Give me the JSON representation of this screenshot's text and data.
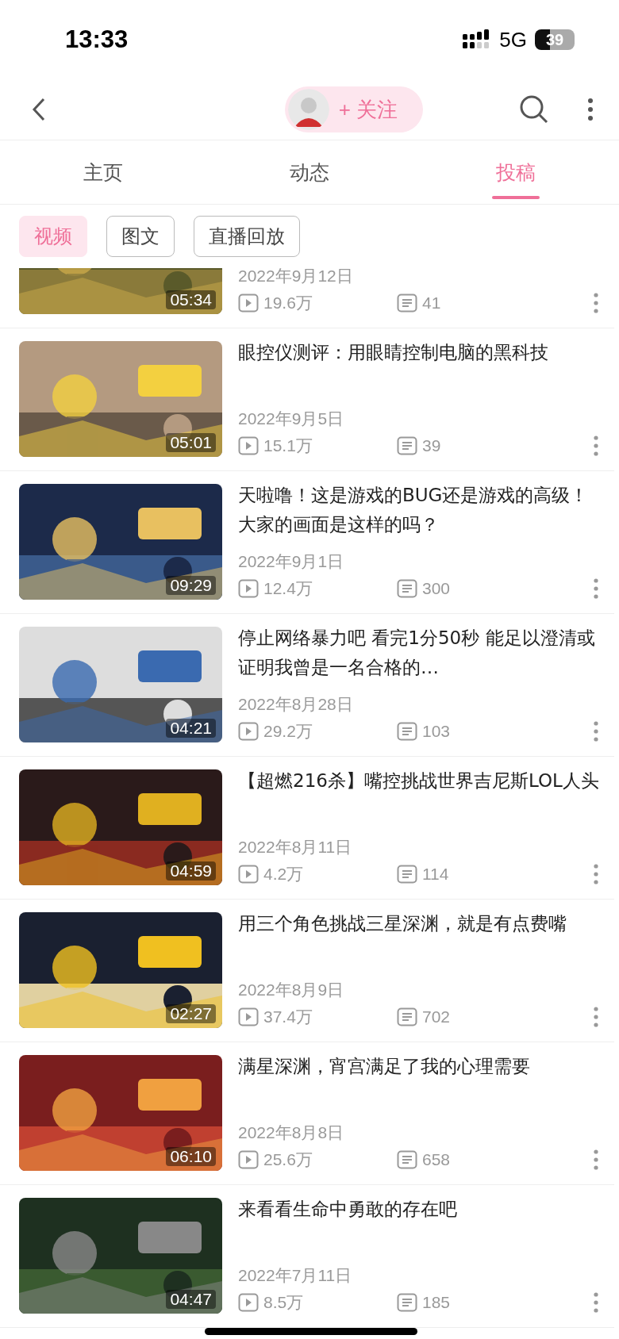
{
  "status_bar": {
    "time": "13:33",
    "network": "5G",
    "battery": "39"
  },
  "nav": {
    "follow_label": "+ 关注"
  },
  "tabs": [
    {
      "label": "主页",
      "selected": false
    },
    {
      "label": "动态",
      "selected": false
    },
    {
      "label": "投稿",
      "selected": true
    }
  ],
  "filters": [
    {
      "label": "视频",
      "selected": true
    },
    {
      "label": "图文",
      "selected": false
    },
    {
      "label": "直播回放",
      "selected": false
    }
  ],
  "videos": [
    {
      "duration": "05:34",
      "date": "2022年9月12日",
      "views": "19.6万",
      "comments": "41"
    },
    {
      "title": "眼控仪测评：用眼睛控制电脑的黑科技",
      "duration": "05:01",
      "date": "2022年9月5日",
      "views": "15.1万",
      "comments": "39"
    },
    {
      "title": "天啦噜！这是游戏的BUG还是游戏的高级！大家的画面是这样的吗？",
      "duration": "09:29",
      "date": "2022年9月1日",
      "views": "12.4万",
      "comments": "300"
    },
    {
      "title": "停止网络暴力吧 看完1分50秒 能足以澄清或证明我曾是一名合格的…",
      "duration": "04:21",
      "date": "2022年8月28日",
      "views": "29.2万",
      "comments": "103"
    },
    {
      "title": "【超燃216杀】嘴控挑战世界吉尼斯LOL人头",
      "duration": "04:59",
      "date": "2022年8月11日",
      "views": "4.2万",
      "comments": "114"
    },
    {
      "title": "用三个角色挑战三星深渊，就是有点费嘴",
      "duration": "02:27",
      "date": "2022年8月9日",
      "views": "37.4万",
      "comments": "702"
    },
    {
      "title": "满星深渊，宵宫满足了我的心理需要",
      "duration": "06:10",
      "date": "2022年8月8日",
      "views": "25.6万",
      "comments": "658"
    },
    {
      "title": "来看看生命中勇敢的存在吧",
      "duration": "04:47",
      "date": "2022年7月11日",
      "views": "8.5万",
      "comments": "185"
    }
  ]
}
